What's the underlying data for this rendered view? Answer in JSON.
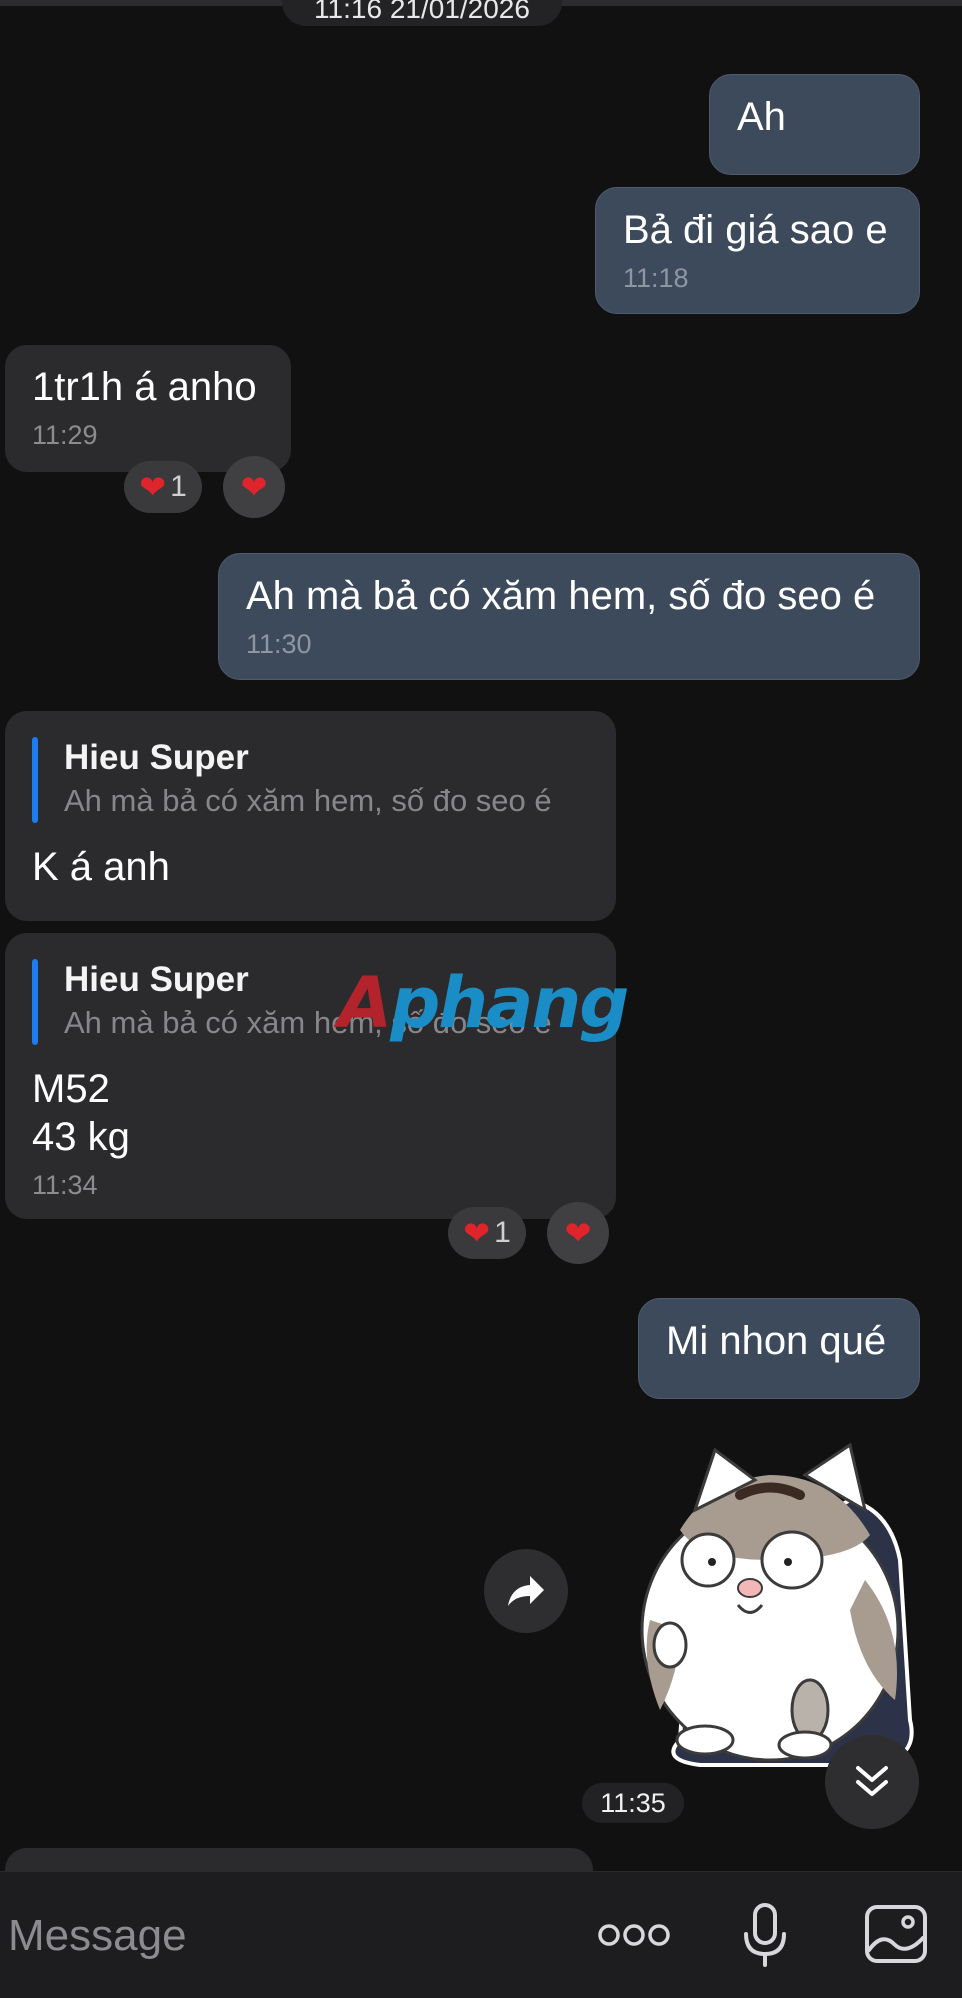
{
  "date_separator": "11:16 21/01/2026",
  "messages": [
    {
      "text": "Ah",
      "time": ""
    },
    {
      "text": "Bả đi giá sao e",
      "time": "11:18"
    },
    {
      "text": "1tr1h á anho",
      "time": "11:29",
      "reaction_count": "1"
    },
    {
      "text": "Ah mà bả có xăm hem, số đo seo é",
      "time": "11:30"
    },
    {
      "reply_author": "Hieu Super",
      "reply_snippet": "Ah mà bả có xăm hem, số đo seo é",
      "text": "K á anh",
      "time": ""
    },
    {
      "reply_author": "Hieu Super",
      "reply_snippet": "Ah mà bả có xăm hem, số đo seo é",
      "text": "M52\n43 kg",
      "time": "11:34",
      "reaction_count": "1"
    },
    {
      "text": "Mi nhon qué",
      "time": ""
    },
    {
      "sticker": "chubby-cat-sticker",
      "time": "11:35"
    }
  ],
  "watermark": {
    "first": "A",
    "rest": "phang"
  },
  "composer": {
    "placeholder": "Message"
  },
  "icons": {
    "heart": "heart-icon",
    "forward": "forward-arrow-icon",
    "scroll_down": "double-chevron-down-icon",
    "more": "more-dots-icon",
    "mic": "microphone-icon",
    "gallery": "image-gallery-icon"
  },
  "colors": {
    "background": "#111112",
    "outgoing_bubble": "#3d4a5c",
    "incoming_bubble": "#2b2b2d",
    "reply_accent": "#1e7bf0",
    "heart": "#e0242c"
  }
}
